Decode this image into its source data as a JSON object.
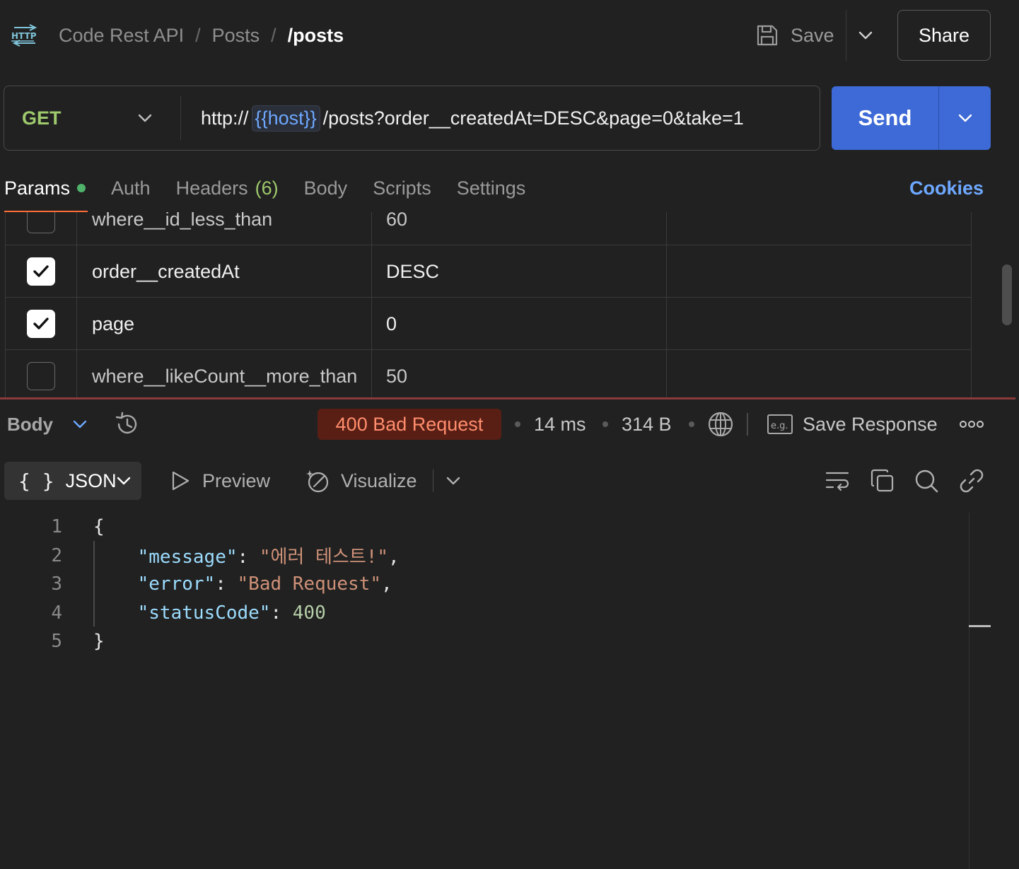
{
  "header": {
    "breadcrumb": [
      "Code Rest API",
      "Posts"
    ],
    "breadcrumb_separator": "/",
    "current": "/posts",
    "save_label": "Save",
    "share_label": "Share",
    "icon": "http-icon"
  },
  "request": {
    "method": "GET",
    "url_prefix": "http://",
    "url_variable": "{{host}}",
    "url_suffix": "/posts?order__createdAt=DESC&page=0&take=1",
    "send_label": "Send"
  },
  "tabs": [
    {
      "label": "Params",
      "active": true,
      "dot": true
    },
    {
      "label": "Auth"
    },
    {
      "label": "Headers",
      "count": "(6)"
    },
    {
      "label": "Body"
    },
    {
      "label": "Scripts"
    },
    {
      "label": "Settings"
    }
  ],
  "cookies_label": "Cookies",
  "params": [
    {
      "checked": false,
      "key": "where__id_less_than",
      "value": "60"
    },
    {
      "checked": true,
      "key": "order__createdAt",
      "value": "DESC"
    },
    {
      "checked": true,
      "key": "page",
      "value": "0"
    },
    {
      "checked": false,
      "key": "where__likeCount__more_than",
      "value": "50"
    }
  ],
  "response": {
    "body_label": "Body",
    "status": "400 Bad Request",
    "time": "14 ms",
    "size": "314 B",
    "save_response_label": "Save Response",
    "format_label": "JSON",
    "braces": "{ }",
    "preview_label": "Preview",
    "visualize_label": "Visualize",
    "line_numbers": [
      "1",
      "2",
      "3",
      "4",
      "5"
    ],
    "code": {
      "open": "{",
      "message_key": "\"message\"",
      "message_value": "\"에러 테스트!\"",
      "error_key": "\"error\"",
      "error_value": "\"Bad Request\"",
      "status_key": "\"statusCode\"",
      "status_value": "400",
      "close": "}"
    }
  },
  "colors": {
    "accent_blue": "#3d6ad6",
    "method_green": "#9ec96c",
    "status_error": "#ff8d6e",
    "active_tab_underline": "#ff6c37"
  }
}
